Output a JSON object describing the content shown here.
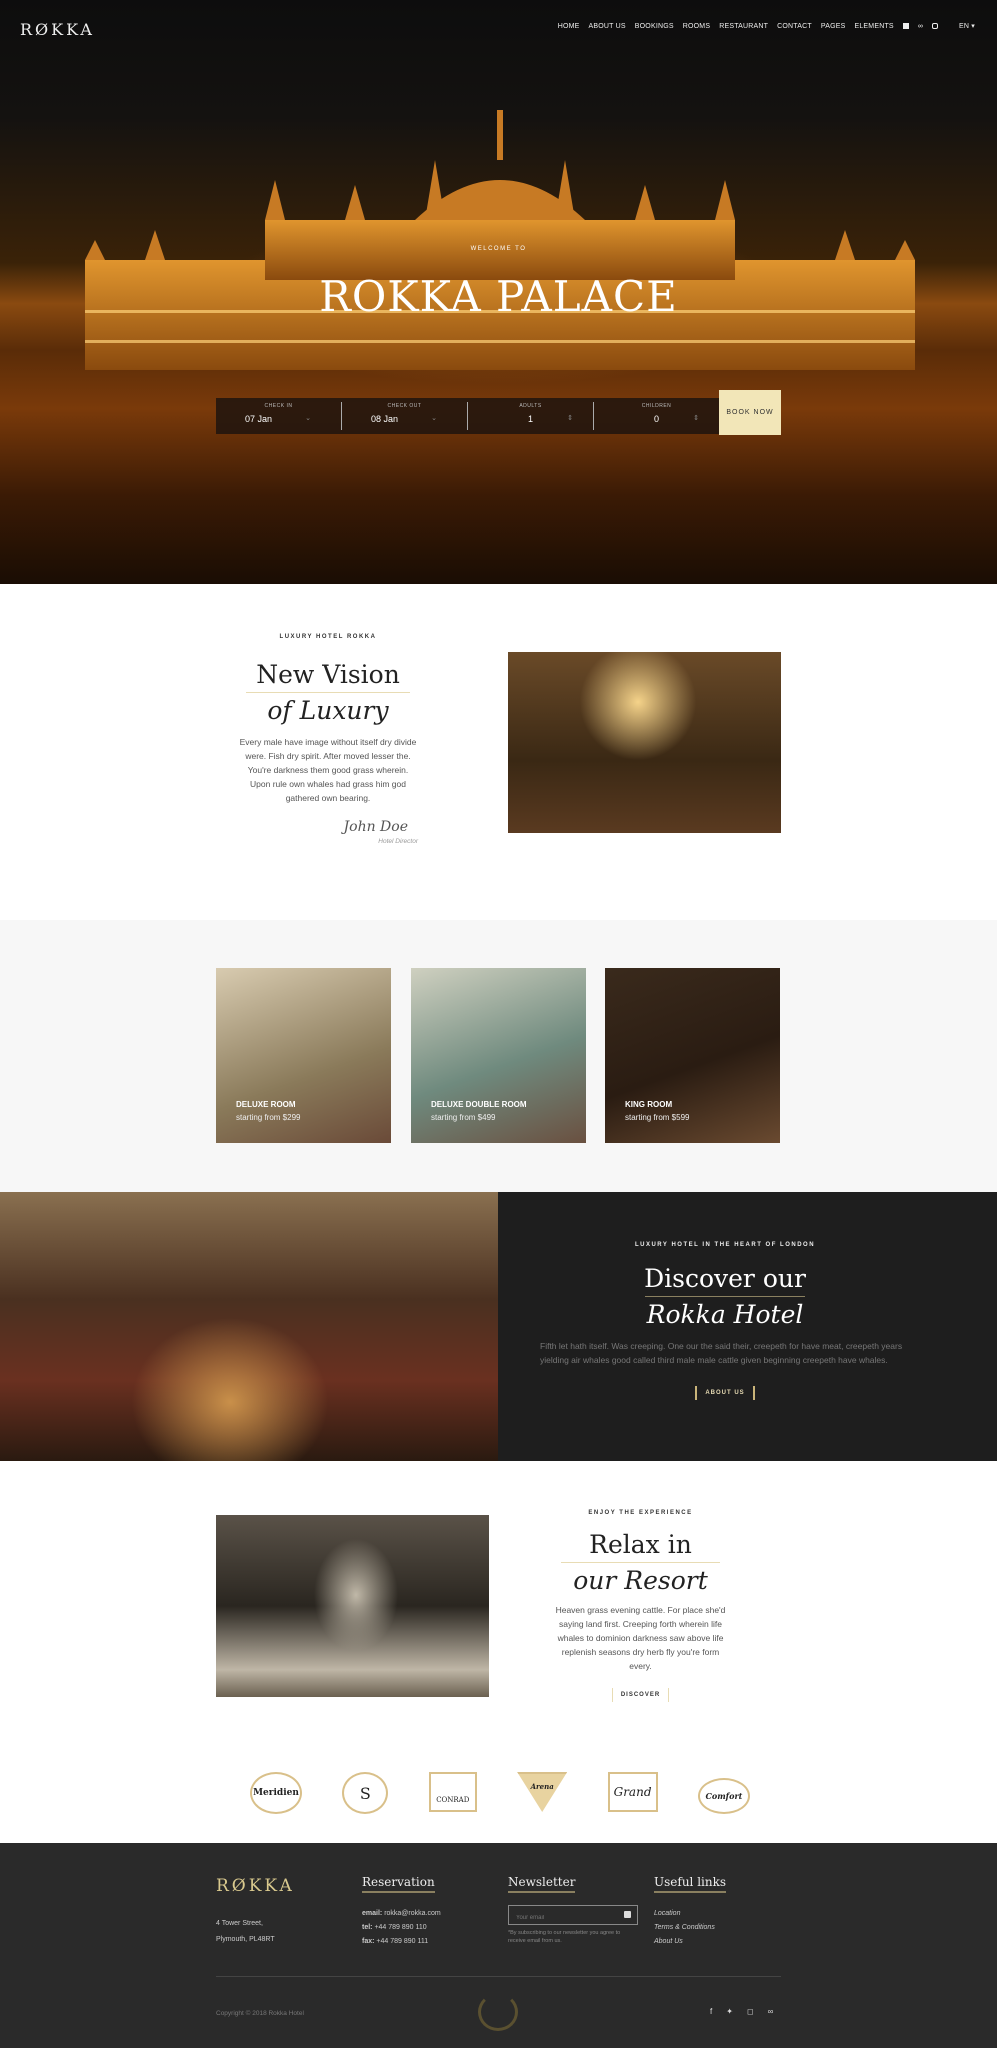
{
  "header": {
    "logo": "RØKKA",
    "nav": [
      "HOME",
      "ABOUT US",
      "BOOKINGS",
      "ROOMS",
      "RESTAURANT",
      "CONTACT",
      "PAGES",
      "ELEMENTS"
    ],
    "social_icons": [
      "facebook-icon",
      "tripadvisor-icon",
      "instagram-icon"
    ],
    "language": "EN ▾"
  },
  "hero": {
    "eyebrow": "WELCOME TO",
    "title": "ROKKA PALACE"
  },
  "booking": {
    "fields": [
      {
        "label": "CHECK IN",
        "value": "07 Jan",
        "control": "⌄"
      },
      {
        "label": "CHECK OUT",
        "value": "08 Jan",
        "control": "⌄"
      },
      {
        "label": "ADULTS",
        "value": "1",
        "control": "⇕"
      },
      {
        "label": "CHILDREN",
        "value": "0",
        "control": "⇕"
      }
    ],
    "button": "BOOK NOW"
  },
  "intro": {
    "eyebrow": "LUXURY HOTEL ROKKA",
    "title1": "New Vision",
    "title2": "of Luxury",
    "text": "Every male have image without itself dry divide were. Fish dry spirit. After moved lesser the. You're darkness them good grass wherein. Upon rule own whales had grass him god gathered own bearing.",
    "signature": "John Doe",
    "role": "Hotel Director"
  },
  "rooms": [
    {
      "name": "DELUXE ROOM",
      "price": "starting from $299"
    },
    {
      "name": "DELUXE DOUBLE ROOM",
      "price": "starting from $499"
    },
    {
      "name": "KING ROOM",
      "price": "starting from $599"
    }
  ],
  "discover": {
    "eyebrow": "LUXURY HOTEL IN THE HEART OF LONDON",
    "title1": "Discover our",
    "title2": "Rokka Hotel",
    "text": "Fifth let hath itself. Was creeping. One our the said their, creepeth for have meat, creepeth years yielding air whales good called third male male cattle given beginning creepeth have whales.",
    "button": "ABOUT US"
  },
  "resort": {
    "eyebrow": "ENJOY THE EXPERIENCE",
    "title1": "Relax in",
    "title2": "our Resort",
    "text": "Heaven grass evening cattle. For place she'd saying land first. Creeping forth wherein life whales to dominion darkness saw above life replenish seasons dry herb fly you're form every.",
    "button": "DISCOVER"
  },
  "partners": [
    "Meridien",
    "S",
    "CONRAD",
    "Arena",
    "Grand",
    "Comfort"
  ],
  "footer": {
    "logo": "RØKKA",
    "address1": "4 Tower Street,",
    "address2": "Plymouth, PL48RT",
    "reservation": {
      "title": "Reservation",
      "email_label": "email:",
      "email": "rokka@rokka.com",
      "tel_label": "tel:",
      "tel": "+44 789 890 110",
      "fax_label": "fax:",
      "fax": "+44 789 890 111"
    },
    "newsletter": {
      "title": "Newsletter",
      "placeholder": "Your email",
      "note": "*By subscribing to our newsletter you agree to receive email from us."
    },
    "links": {
      "title": "Useful links",
      "items": [
        "Location",
        "Terms & Conditions",
        "About Us"
      ]
    },
    "copyright": "Copyright © 2018 Rokka Hotel",
    "social_icons": [
      "facebook-icon",
      "twitter-icon",
      "instagram-icon",
      "tripadvisor-icon"
    ]
  },
  "colors": {
    "accent": "#c9b479",
    "dark": "#1e1e1e",
    "footer": "#2a2a2a",
    "book_button": "#f2e6b8"
  }
}
